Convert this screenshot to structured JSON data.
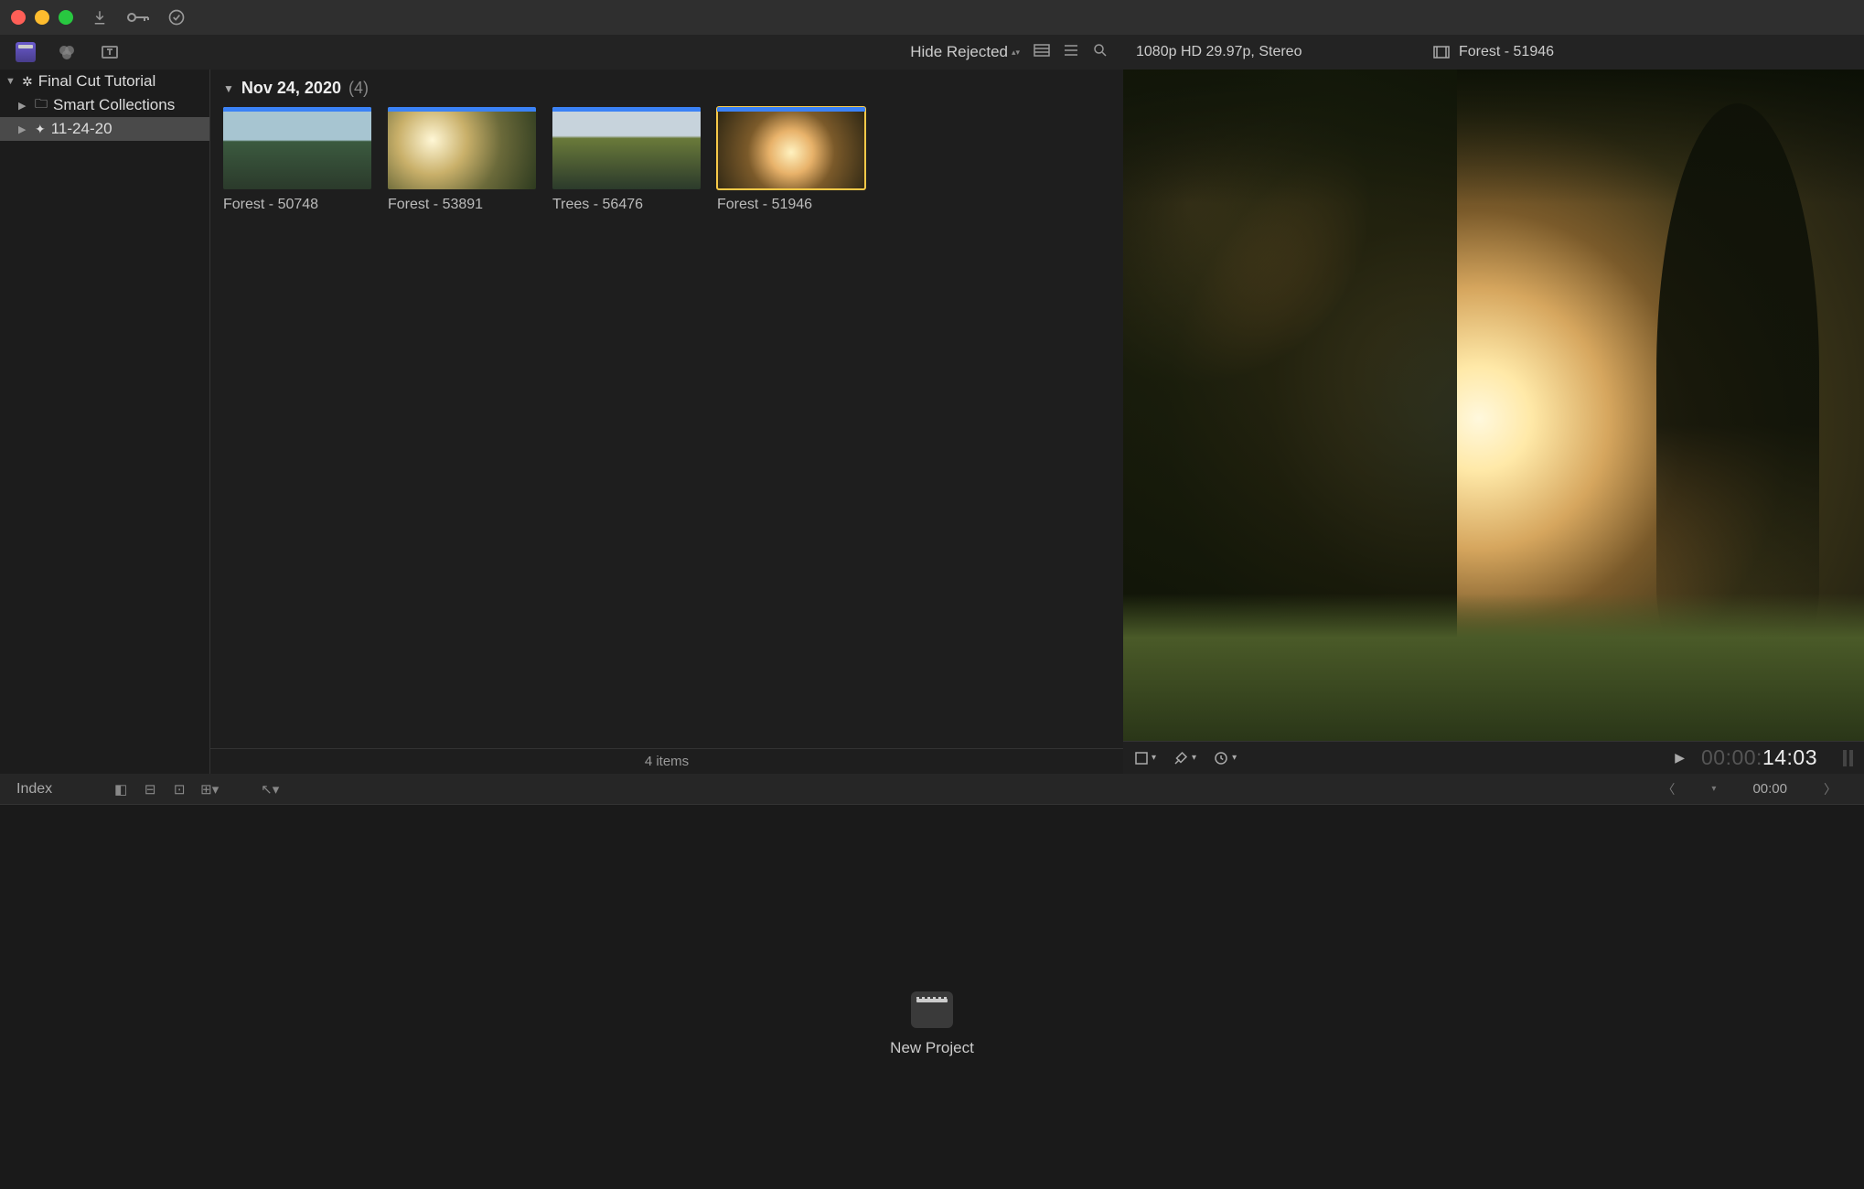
{
  "titlebar": {
    "import_tooltip": "Import",
    "key_label": "⚬—",
    "check_tooltip": "Background tasks"
  },
  "tabbar": {
    "media_tab": "Media",
    "effects_tab": "Effects",
    "titles_tab": "Titles",
    "hide_rejected": "Hide Rejected",
    "video_info": "1080p HD 29.97p, Stereo",
    "clip_title": "Forest - 51946"
  },
  "sidebar": {
    "library": "Final Cut Tutorial",
    "smart": "Smart Collections",
    "event": "11-24-20"
  },
  "browser": {
    "date": "Nov 24, 2020",
    "count": "(4)",
    "clips": [
      {
        "label": "Forest - 50748"
      },
      {
        "label": "Forest - 53891"
      },
      {
        "label": "Trees - 56476"
      },
      {
        "label": "Forest - 51946"
      }
    ],
    "footer": "4 items"
  },
  "viewer": {
    "timecode_dim": "00:00:",
    "timecode_bright": "14:03"
  },
  "timeline": {
    "index_label": "Index",
    "tc": "00:00",
    "new_project": "New Project"
  }
}
